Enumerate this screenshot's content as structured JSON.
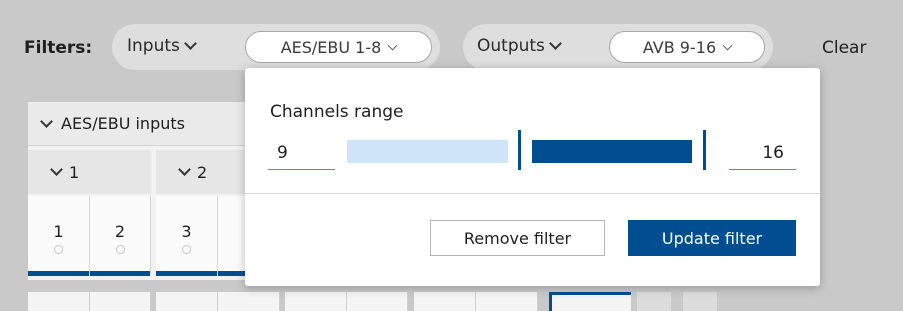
{
  "filters": {
    "label": "Filters:",
    "inputs": {
      "label": "Inputs",
      "selection": "AES/EBU 1-8"
    },
    "outputs": {
      "label": "Outputs",
      "selection": "AVB 9-16"
    },
    "clear_label": "Clear"
  },
  "background": {
    "section_title": "AES/EBU inputs",
    "groups": [
      {
        "label": "1"
      },
      {
        "label": "2"
      }
    ],
    "channels": [
      {
        "label": "1"
      },
      {
        "label": "2"
      },
      {
        "label": "3"
      }
    ]
  },
  "popover": {
    "title": "Channels range",
    "range": {
      "min": "9",
      "max": "16"
    },
    "remove_label": "Remove filter",
    "update_label": "Update filter"
  },
  "colors": {
    "accent": "#004e92",
    "track_light": "#cfe4f9",
    "background": "#c9c9c9"
  },
  "icons": {
    "dropdown": "chevron-down-icon",
    "section_toggle": "chevron-down-icon"
  }
}
